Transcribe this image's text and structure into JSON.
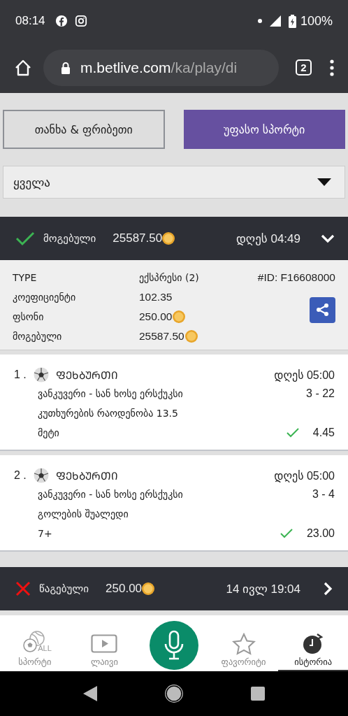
{
  "status_bar": {
    "time": "08:14",
    "battery": "100%"
  },
  "browser": {
    "url_host": "m.betlive.com",
    "url_path": "/ka/play/di",
    "tab_count": "2"
  },
  "tabs": [
    {
      "label": "თანხა & ფრიბეთი",
      "selected": false
    },
    {
      "label": "უფასო სპორტი",
      "selected": true
    }
  ],
  "filter": {
    "value": "ყველა"
  },
  "bets": [
    {
      "won": true,
      "status_label": "მოგებული",
      "amount": "25587.50",
      "time": "დღეს 04:49",
      "expanded": true,
      "details": {
        "type_label": "TYPE",
        "type_value": "ექსპრესი (2)",
        "id": "#ID: F16608000",
        "rows": [
          {
            "label": "კოეფიციენტი",
            "value": "102.35",
            "coin": false
          },
          {
            "label": "ფსონი",
            "value": "250.00",
            "coin": true
          },
          {
            "label": "მოგებული",
            "value": "25587.50",
            "coin": true
          }
        ]
      },
      "selections": [
        {
          "index": "1 .",
          "sport": "ᲤᲔᲮᲑᲣᲠᲗᲘ",
          "time": "დღეს 05:00",
          "match": "ვანკუვერი - სან ხოსე ერსქუკსი",
          "score": "3 - 22",
          "market": "კუთხურების რაოდენობა 13.5",
          "pick": "მეტი",
          "won": true,
          "odds": "4.45"
        },
        {
          "index": "2 .",
          "sport": "ᲤᲔᲮᲑᲣᲠᲗᲘ",
          "time": "დღეს 05:00",
          "match": "ვანკუვერი - სან ხოსე ერსქუკსი",
          "score": "3 - 4",
          "market": "გოლების შუალედი",
          "pick": "7+",
          "won": true,
          "odds": "23.00"
        }
      ]
    },
    {
      "won": false,
      "status_label": "წაგებული",
      "amount": "250.00",
      "time": "14 ივლ 19:04",
      "expanded": false
    }
  ],
  "bottom_nav": [
    {
      "kind": "sports",
      "label": "სპორტი",
      "icon_text": "ALL",
      "selected": false
    },
    {
      "kind": "live",
      "label": "ლაივი",
      "selected": false
    },
    {
      "kind": "mic"
    },
    {
      "kind": "favorites",
      "label": "ფავორიტი",
      "selected": false
    },
    {
      "kind": "history",
      "label": "ისტორია",
      "selected": true
    }
  ]
}
